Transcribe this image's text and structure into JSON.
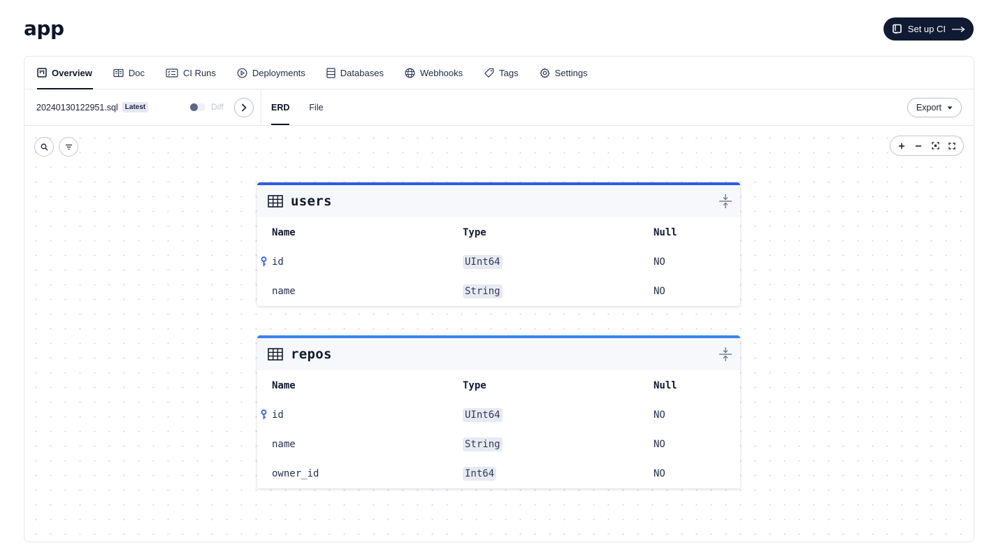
{
  "app": {
    "title": "app",
    "setup_label": "Set up CI"
  },
  "tabs": [
    {
      "label": "Overview"
    },
    {
      "label": "Doc"
    },
    {
      "label": "CI Runs"
    },
    {
      "label": "Deployments"
    },
    {
      "label": "Databases"
    },
    {
      "label": "Webhooks"
    },
    {
      "label": "Tags"
    },
    {
      "label": "Settings"
    }
  ],
  "file": {
    "name": "20240130122951.sql",
    "badge": "Latest",
    "diff_label": "Diff"
  },
  "view_tabs": [
    {
      "label": "ERD"
    },
    {
      "label": "File"
    }
  ],
  "export_label": "Export",
  "columns": {
    "name": "Name",
    "type": "Type",
    "null": "Null"
  },
  "tables": [
    {
      "name": "users",
      "accent": "#2f5be6",
      "rows": [
        {
          "name": "id",
          "type": "UInt64",
          "null": "NO",
          "pk": true
        },
        {
          "name": "name",
          "type": "String",
          "null": "NO",
          "pk": false
        }
      ]
    },
    {
      "name": "repos",
      "accent": "#3b82f0",
      "rows": [
        {
          "name": "id",
          "type": "UInt64",
          "null": "NO",
          "pk": true
        },
        {
          "name": "name",
          "type": "String",
          "null": "NO",
          "pk": false
        },
        {
          "name": "owner_id",
          "type": "Int64",
          "null": "NO",
          "pk": false
        }
      ]
    }
  ]
}
